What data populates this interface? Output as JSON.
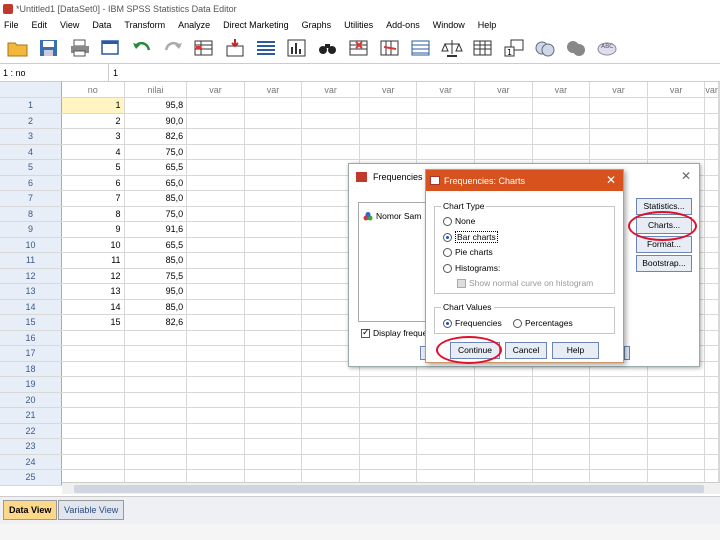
{
  "window": {
    "title": "*Untitled1 [DataSet0] - IBM SPSS Statistics Data Editor"
  },
  "menu": [
    "File",
    "Edit",
    "View",
    "Data",
    "Transform",
    "Analyze",
    "Direct Marketing",
    "Graphs",
    "Utilities",
    "Add-ons",
    "Window",
    "Help"
  ],
  "toolbar_icons": [
    "open-folder-icon",
    "save-icon",
    "print-icon",
    "dialog-recall-icon",
    "undo-icon",
    "redo-icon",
    "goto-case-icon",
    "goto-variable-icon",
    "variables-icon",
    "run-descriptives-icon",
    "find-icon",
    "insert-cases-icon",
    "insert-variable-icon",
    "split-file-icon",
    "weight-cases-icon",
    "select-cases-icon",
    "value-labels-icon",
    "use-sets-icon",
    "show-all-variables-icon",
    "spelling-icon"
  ],
  "cellbar": {
    "ref": "1 : no",
    "value": "1"
  },
  "grid": {
    "columns": [
      "no",
      "nilai",
      "var",
      "var",
      "var",
      "var",
      "var",
      "var",
      "var",
      "var",
      "var",
      "var"
    ],
    "row_numbers": [
      "1",
      "2",
      "3",
      "4",
      "5",
      "6",
      "7",
      "8",
      "9",
      "10",
      "11",
      "12",
      "13",
      "14",
      "15",
      "16",
      "17",
      "18",
      "19",
      "20",
      "21",
      "22",
      "23",
      "24",
      "25"
    ],
    "rows": [
      [
        "1",
        "95,8"
      ],
      [
        "2",
        "90,0"
      ],
      [
        "3",
        "82,6"
      ],
      [
        "4",
        "75,0"
      ],
      [
        "5",
        "65,5"
      ],
      [
        "6",
        "65,0"
      ],
      [
        "7",
        "85,0"
      ],
      [
        "8",
        "75,0"
      ],
      [
        "9",
        "91,6"
      ],
      [
        "10",
        "65,5"
      ],
      [
        "11",
        "85,0"
      ],
      [
        "12",
        "75,5"
      ],
      [
        "13",
        "95,0"
      ],
      [
        "14",
        "85,0"
      ],
      [
        "15",
        "82,6"
      ]
    ]
  },
  "tabs": {
    "data_view": "Data View",
    "variable_view": "Variable View"
  },
  "frequencies_dialog": {
    "title": "Frequencies",
    "variable_item": "Nomor Sam",
    "display_tables": "Display freque",
    "buttons": {
      "statistics": "Statistics...",
      "charts": "Charts...",
      "format": "Format...",
      "bootstrap": "Bootstrap..."
    }
  },
  "charts_dialog": {
    "title": "Frequencies: Charts",
    "chart_type": {
      "legend": "Chart Type",
      "options": [
        "None",
        "Bar charts",
        "Pie charts",
        "Histograms:"
      ],
      "selected": "Bar charts",
      "normal_curve": "Show normal curve on histogram"
    },
    "chart_values": {
      "legend": "Chart Values",
      "options": [
        "Frequencies",
        "Percentages"
      ],
      "selected": "Frequencies"
    },
    "buttons": {
      "continue": "Continue",
      "cancel": "Cancel",
      "help": "Help"
    }
  },
  "highlight_color": "#e0102b"
}
